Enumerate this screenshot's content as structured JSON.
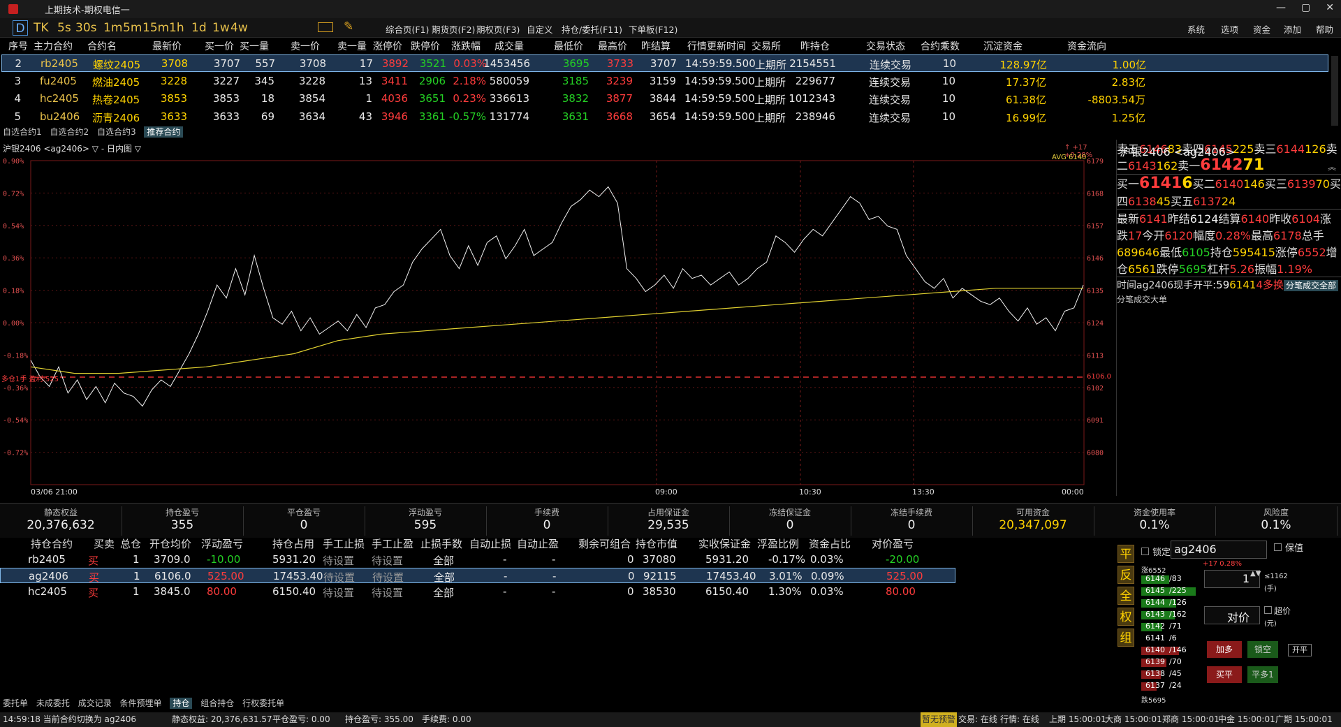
{
  "window": {
    "title": "上期技术-期权电信一",
    "controls": [
      "—",
      "▢",
      "✕"
    ]
  },
  "toolbar": {
    "timeframes": [
      "D",
      "TK",
      "5s",
      "30s",
      "1m",
      "5m",
      "15m",
      "1h",
      "1d",
      "1w",
      "4w"
    ],
    "menus": [
      "综合页(F1)",
      "期货页(F2)",
      "期权页(F3)",
      "自定义",
      "持仓/委托(F11)",
      "下单板(F12)"
    ],
    "right_menus": [
      "系统",
      "选项",
      "资金",
      "添加",
      "帮助"
    ]
  },
  "market": {
    "headers": [
      "序号",
      "主力合约",
      "合约名",
      "最新价",
      "买一价",
      "买一量",
      "卖一价",
      "卖一量",
      "涨停价",
      "跌停价",
      "涨跌幅",
      "成交量",
      "最低价",
      "最高价",
      "昨结算",
      "行情更新时间",
      "交易所",
      "昨持仓",
      "交易状态",
      "合约乘数",
      "沉淀资金",
      "资金流向"
    ],
    "rows": [
      {
        "no": "2",
        "code": "rb2405",
        "name": "螺纹2405",
        "last": "3708",
        "bid": "3707",
        "bidv": "557",
        "ask": "3708",
        "askv": "17",
        "up": "3892",
        "down": "3521",
        "chg": "0.03%",
        "vol": "1453456",
        "low": "3695",
        "high": "3733",
        "pre": "3707",
        "time": "14:59:59.500",
        "ex": "上期所",
        "oi": "2154551",
        "st": "连续交易",
        "mul": "10",
        "fund": "128.97亿",
        "flow": "1.00亿"
      },
      {
        "no": "3",
        "code": "fu2405",
        "name": "燃油2405",
        "last": "3228",
        "bid": "3227",
        "bidv": "345",
        "ask": "3228",
        "askv": "13",
        "up": "3411",
        "down": "2906",
        "chg": "2.18%",
        "vol": "580059",
        "low": "3185",
        "high": "3239",
        "pre": "3159",
        "time": "14:59:59.500",
        "ex": "上期所",
        "oi": "229677",
        "st": "连续交易",
        "mul": "10",
        "fund": "17.37亿",
        "flow": "2.83亿"
      },
      {
        "no": "4",
        "code": "hc2405",
        "name": "热卷2405",
        "last": "3853",
        "bid": "3853",
        "bidv": "18",
        "ask": "3854",
        "askv": "1",
        "up": "4036",
        "down": "3651",
        "chg": "0.23%",
        "vol": "336613",
        "low": "3832",
        "high": "3877",
        "pre": "3844",
        "time": "14:59:59.500",
        "ex": "上期所",
        "oi": "1012343",
        "st": "连续交易",
        "mul": "10",
        "fund": "61.38亿",
        "flow": "-8803.54万"
      },
      {
        "no": "5",
        "code": "bu2406",
        "name": "沥青2406",
        "last": "3633",
        "bid": "3633",
        "bidv": "69",
        "ask": "3634",
        "askv": "43",
        "up": "3946",
        "down": "3361",
        "chg": "-0.57%",
        "vol": "131774",
        "low": "3631",
        "high": "3668",
        "pre": "3654",
        "time": "14:59:59.500",
        "ex": "上期所",
        "oi": "238946",
        "st": "连续交易",
        "mul": "10",
        "fund": "16.99亿",
        "flow": "1.25亿"
      }
    ],
    "watch_tabs": [
      "自选合约1",
      "自选合约2",
      "自选合约3",
      "推荐合约"
    ]
  },
  "chart": {
    "header": "沪银2406 <ag2406> ▽ - 日内图 ▽",
    "top_right": "↑ +17 +0.28%",
    "avg_label": "AVG 6140",
    "pos_label": "多仓1手 盈利:525",
    "pos_price": "6106.0",
    "left_ticks": [
      "0.90%",
      "0.72%",
      "0.54%",
      "0.36%",
      "0.18%",
      "0.00%",
      "-0.18%",
      "-0.36%",
      "-0.54%",
      "-0.72%"
    ],
    "right_ticks": [
      "6179",
      "6168",
      "6157",
      "6146",
      "6135",
      "6124",
      "6113",
      "6102",
      "6091",
      "6080"
    ],
    "time_labels": [
      "03/06 21:00",
      "09:00",
      "10:30",
      "13:30",
      "00:00"
    ]
  },
  "chart_data": {
    "type": "line",
    "title": "沪银2406 <ag2406>",
    "ylim": [
      6080,
      6179
    ],
    "series": [
      {
        "name": "价格",
        "values": [
          6118,
          6113,
          6110,
          6116,
          6108,
          6112,
          6106,
          6110,
          6105,
          6111,
          6108,
          6107,
          6104,
          6109,
          6112,
          6110,
          6115,
          6120,
          6126,
          6133,
          6141,
          6137,
          6146,
          6138,
          6150,
          6140,
          6131,
          6129,
          6133,
          6127,
          6131,
          6126,
          6128,
          6130,
          6127,
          6132,
          6128,
          6134,
          6135,
          6139,
          6141,
          6148,
          6152,
          6155,
          6158,
          6150,
          6146,
          6153,
          6147,
          6154,
          6156,
          6149,
          6153,
          6158,
          6150,
          6152,
          6154,
          6160,
          6165,
          6167,
          6170,
          6168,
          6171,
          6166,
          6146,
          6143,
          6139,
          6141,
          6144,
          6140,
          6146,
          6143,
          6144,
          6141,
          6143,
          6145,
          6141,
          6143,
          6146,
          6148,
          6156,
          6154,
          6151,
          6155,
          6158,
          6156,
          6160,
          6164,
          6168,
          6166,
          6161,
          6162,
          6159,
          6158,
          6150,
          6146,
          6142,
          6140,
          6143,
          6137,
          6140,
          6138,
          6136,
          6135,
          6137,
          6133,
          6130,
          6134,
          6129,
          6131,
          6127,
          6133,
          6134,
          6141
        ]
      },
      {
        "name": "AVG",
        "values": [
          6116,
          6114,
          6114,
          6115,
          6116,
          6118,
          6120,
          6124,
          6126,
          6127,
          6128,
          6129,
          6130,
          6131,
          6132,
          6133,
          6134,
          6135,
          6136,
          6137,
          6138,
          6139,
          6140,
          6140,
          6140
        ]
      }
    ]
  },
  "quote": {
    "title": "沪银2406 <ag2406>",
    "asks": [
      {
        "l": "卖五",
        "p": "6146",
        "v": "83"
      },
      {
        "l": "卖四",
        "p": "6145",
        "v": "225"
      },
      {
        "l": "卖三",
        "p": "6144",
        "v": "126"
      },
      {
        "l": "卖二",
        "p": "6143",
        "v": "162"
      },
      {
        "l": "卖一",
        "p": "6142",
        "v": "71"
      }
    ],
    "bids": [
      {
        "l": "买一",
        "p": "6141",
        "v": "6"
      },
      {
        "l": "买二",
        "p": "6140",
        "v": "146"
      },
      {
        "l": "买三",
        "p": "6139",
        "v": "70"
      },
      {
        "l": "买四",
        "p": "6138",
        "v": "45"
      },
      {
        "l": "买五",
        "p": "6137",
        "v": "24"
      }
    ],
    "stats": [
      {
        "l1": "最新",
        "v1": "6141",
        "l2": "昨结",
        "v2": "6124"
      },
      {
        "l1": "结算",
        "v1": "6140",
        "l2": "昨收",
        "v2": "6104"
      },
      {
        "l1": "涨跌",
        "v1": "17",
        "l2": "今开",
        "v2": "6120"
      },
      {
        "l1": "幅度",
        "v1": "0.28%",
        "l2": "最高",
        "v2": "6178"
      },
      {
        "l1": "总手",
        "v1": "689646",
        "l2": "最低",
        "v2": "6105"
      },
      {
        "l1": "持仓",
        "v1": "595415",
        "l2": "涨停",
        "v2": "6552"
      },
      {
        "l1": "增仓",
        "v1": "6561",
        "l2": "跌停",
        "v2": "5695"
      },
      {
        "l1": "杠杆",
        "v1": "5.26",
        "l2": "振幅",
        "v2": "1.19%"
      }
    ],
    "tick_header": [
      "时间",
      "ag2406",
      "现手",
      "开平"
    ],
    "tick_row": [
      ":59",
      "6141",
      "4",
      "多换"
    ],
    "tabs": [
      "分笔成交全部",
      "分笔成交大单"
    ]
  },
  "account": {
    "items": [
      {
        "k": "静态权益",
        "v": "20,376,632"
      },
      {
        "k": "持仓盈亏",
        "v": "355"
      },
      {
        "k": "平仓盈亏",
        "v": "0"
      },
      {
        "k": "浮动盈亏",
        "v": "595"
      },
      {
        "k": "手续费",
        "v": "0"
      },
      {
        "k": "占用保证金",
        "v": "29,535"
      },
      {
        "k": "冻结保证金",
        "v": "0"
      },
      {
        "k": "冻结手续费",
        "v": "0"
      },
      {
        "k": "可用资金",
        "v": "20,347,097"
      },
      {
        "k": "资金使用率",
        "v": "0.1%"
      },
      {
        "k": "风险度",
        "v": "0.1%"
      }
    ]
  },
  "positions": {
    "headers": [
      "持仓合约",
      "买卖",
      "总仓",
      "开仓均价",
      "浮动盈亏",
      "持仓占用",
      "手工止损",
      "手工止盈",
      "止损手数",
      "自动止损",
      "自动止盈",
      "剩余可组合",
      "持仓市值",
      "实收保证金",
      "浮盈比例",
      "资金占比",
      "对价盈亏"
    ],
    "rows": [
      {
        "c": "rb2405",
        "d": "买",
        "n": "1",
        "avg": "3709.0",
        "fp": "-10.00",
        "occ": "5931.20",
        "sl": "待设置",
        "tp": "待设置",
        "sln": "全部",
        "asl": "-",
        "atp": "-",
        "rem": "0",
        "mv": "37080",
        "mar": "5931.20",
        "ratio": "-0.17%",
        "fr": "0.03%",
        "op": "-20.00"
      },
      {
        "c": "ag2406",
        "d": "买",
        "n": "1",
        "avg": "6106.0",
        "fp": "525.00",
        "occ": "17453.40",
        "sl": "待设置",
        "tp": "待设置",
        "sln": "全部",
        "asl": "-",
        "atp": "-",
        "rem": "0",
        "mv": "92115",
        "mar": "17453.40",
        "ratio": "3.01%",
        "fr": "0.09%",
        "op": "525.00"
      },
      {
        "c": "hc2405",
        "d": "买",
        "n": "1",
        "avg": "3845.0",
        "fp": "80.00",
        "occ": "6150.40",
        "sl": "待设置",
        "tp": "待设置",
        "sln": "全部",
        "asl": "-",
        "atp": "-",
        "rem": "0",
        "mv": "38530",
        "mar": "6150.40",
        "ratio": "1.30%",
        "fr": "0.03%",
        "op": "80.00"
      }
    ],
    "tabs": [
      "委托单",
      "未成委托",
      "成交记录",
      "条件预埋单",
      "持仓",
      "组合持仓",
      "行权委托单"
    ]
  },
  "order": {
    "side_buttons": [
      "平",
      "反",
      "全",
      "权",
      "组"
    ],
    "lock_label": "锁定",
    "contract": "ag2406",
    "keep_label": "保值",
    "change": "+17 0.28%",
    "qty": "1",
    "qty_hint": "≤1162",
    "qty_unit": "(手)",
    "price": "对价",
    "price_unit": "(元)",
    "over_label": "超价",
    "ladder_top": "涨6552",
    "ladder_bottom": "跌5695",
    "ladder": [
      {
        "p": "6146",
        "v": "/83",
        "t": "ask"
      },
      {
        "p": "6145",
        "v": "/225",
        "t": "ask"
      },
      {
        "p": "6144",
        "v": "/126",
        "t": "ask"
      },
      {
        "p": "6143",
        "v": "/162",
        "t": "ask"
      },
      {
        "p": "6142",
        "v": "/71",
        "t": "ask"
      },
      {
        "p": "6141",
        "v": "/6",
        "t": "last"
      },
      {
        "p": "6140",
        "v": "/146",
        "t": "bid"
      },
      {
        "p": "6139",
        "v": "/70",
        "t": "bid"
      },
      {
        "p": "6138",
        "v": "/45",
        "t": "bid"
      },
      {
        "p": "6137",
        "v": "/24",
        "t": "bid"
      }
    ],
    "btn_add": "加多",
    "btn_lock": "锁空",
    "btn_openclose": "开平",
    "btn_buyclose": "买平",
    "btn_flat": "平多1"
  },
  "status": {
    "time": "14:59:18 当前合约切换为 ag2406",
    "items": [
      "静态权益: 20,376,631.57",
      "平仓盈亏: 0.00",
      "持仓盈亏: 355.00",
      "手续费: 0.00"
    ],
    "right": [
      "暂无预警",
      "交易: 在线",
      "行情: 在线",
      "上期 15:00:01",
      "大商 15:00:01",
      "郑商 15:00:01",
      "中金 15:00:01",
      "广期 15:00:01"
    ]
  },
  "colors": {
    "up": "#ff3c3c",
    "down": "#24d024",
    "accent": "#ffd200",
    "select": "#1e3550"
  }
}
